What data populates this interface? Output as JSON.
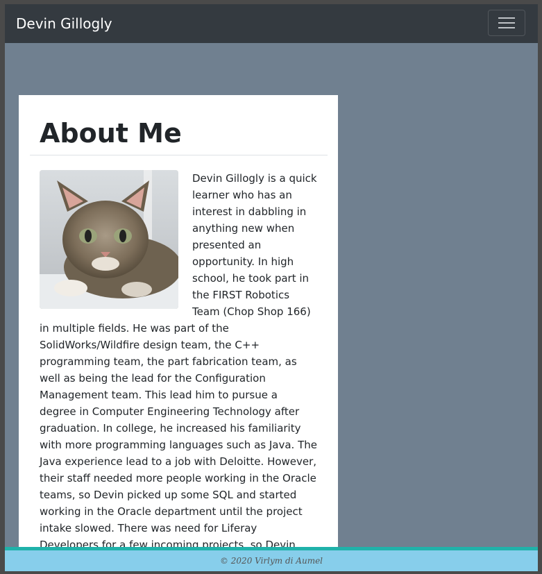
{
  "navbar": {
    "brand": "Devin Gillogly",
    "toggler_icon": "hamburger-menu-icon"
  },
  "card": {
    "heading": "About Me",
    "image_subject": "tabby kitten",
    "paragraph": "Devin Gillogly is a quick learner who has an interest in dabbling in anything new when presented an opportunity. In high school, he took part in the FIRST Robotics Team (Chop Shop 166) in multiple fields. He was part of the SolidWorks/Wildfire design team, the C++ programming team, the part fabrication team, as well as being the lead for the Configuration Management team. This lead him to pursue a degree in Computer Engineering Technology after graduation. In college, he increased his familiarity with more programming languages such as Java. The Java experience lead to a job with Deloitte. However, their staff needed more people working in the Oracle teams, so Devin picked up some SQL and started working in the Oracle department until the project intake slowed. There was need for Liferay Developers for a few incoming projects, so Devin learned Liferay to help out on those projects as well."
  },
  "footer": {
    "text": "© 2020 Virlym di Aumel"
  },
  "colors": {
    "navbar": "#343a40",
    "background": "#708090",
    "footer": "#87ceeb",
    "footer_accent": "#20b2aa"
  }
}
